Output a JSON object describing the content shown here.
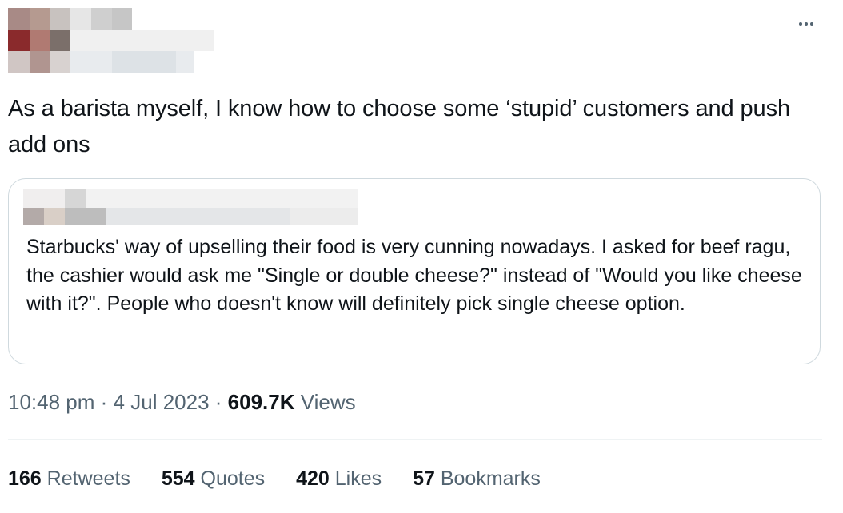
{
  "tweet": {
    "text": "As a barista myself, I know how to choose  some ‘stupid’ customers and push add ons",
    "more_icon": "more-horizontal-icon"
  },
  "quote": {
    "text": "Starbucks' way of upselling their food is very cunning nowadays. I asked for beef ragu, the cashier would ask me \"Single or double cheese?\" instead of \"Would you like cheese with it?\". People who doesn't know will definitely pick single cheese option."
  },
  "meta": {
    "time": "10:48 pm",
    "separator": "·",
    "date": "4 Jul 2023",
    "views_count": "609.7K",
    "views_label": "Views"
  },
  "stats": [
    {
      "count": "166",
      "label": "Retweets"
    },
    {
      "count": "554",
      "label": "Quotes"
    },
    {
      "count": "420",
      "label": "Likes"
    },
    {
      "count": "57",
      "label": "Bookmarks"
    }
  ],
  "colors": {
    "text": "#0f1419",
    "secondary": "#536471",
    "border": "#cfd9de"
  }
}
